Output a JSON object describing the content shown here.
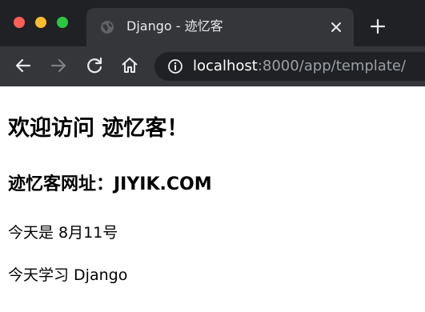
{
  "window": {
    "controls": [
      "close",
      "minimize",
      "maximize"
    ]
  },
  "tab": {
    "title": "Django - 迹忆客",
    "favicon": "globe-icon"
  },
  "toolbar": {
    "url_host": "localhost",
    "url_rest": ":8000/app/template/"
  },
  "page": {
    "heading": "欢迎访问 迹忆客！",
    "subheading": "迹忆客网址：JIYIK.COM",
    "line1": "今天是 8月11号",
    "line2": "今天学习 Django"
  },
  "colors": {
    "titlebar": "#202124",
    "toolbar": "#35363a",
    "tab_text": "#e8eaed",
    "url_dim": "#9aa0a6"
  }
}
